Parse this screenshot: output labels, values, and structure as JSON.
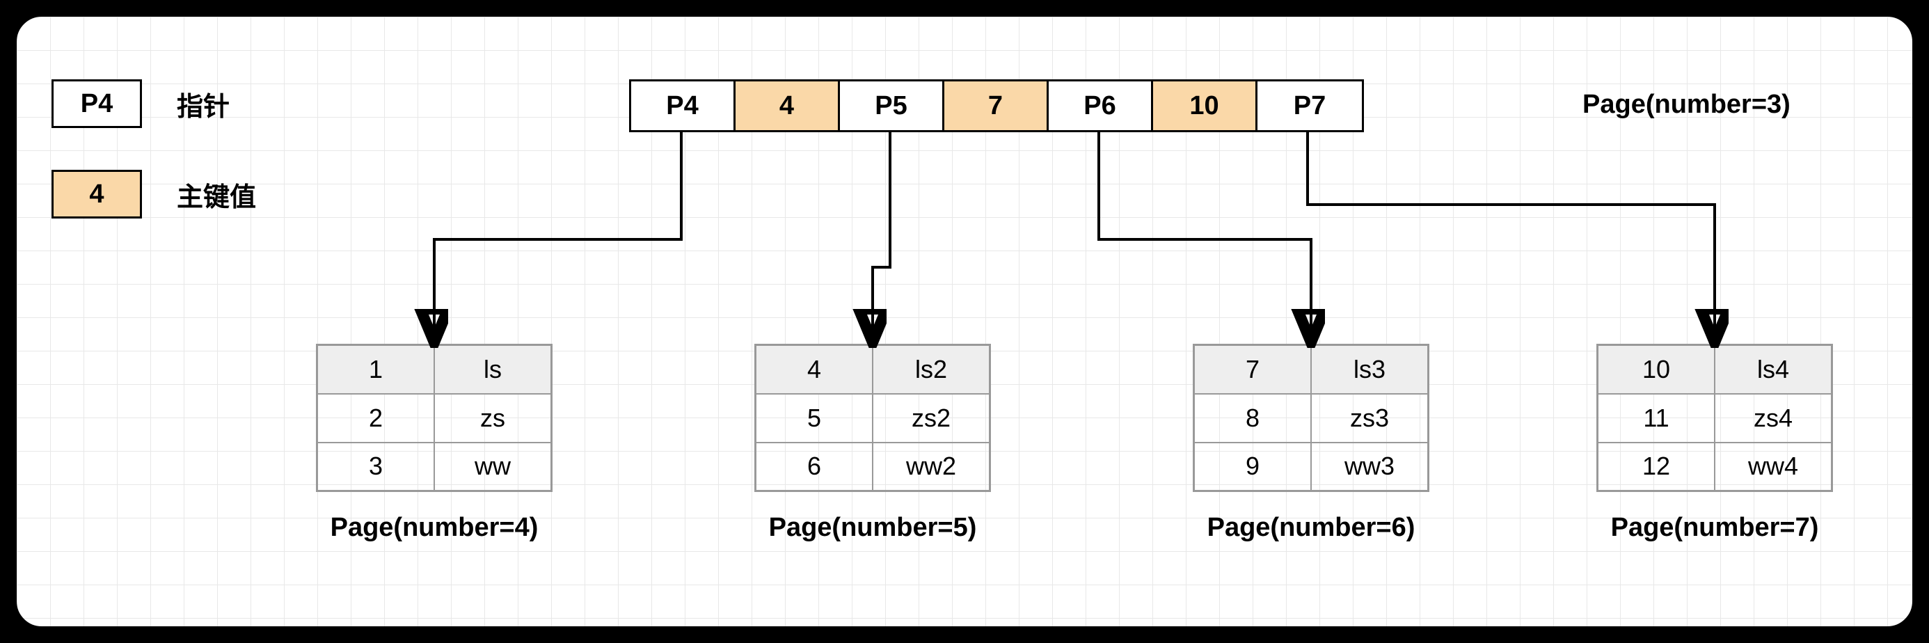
{
  "legend": {
    "pointer_box": "P4",
    "pointer_label": "指针",
    "key_box": "4",
    "key_label": "主键值"
  },
  "index": {
    "cells": [
      {
        "text": "P4",
        "type": "ptr"
      },
      {
        "text": "4",
        "type": "key"
      },
      {
        "text": "P5",
        "type": "ptr"
      },
      {
        "text": "7",
        "type": "key"
      },
      {
        "text": "P6",
        "type": "ptr"
      },
      {
        "text": "10",
        "type": "key"
      },
      {
        "text": "P7",
        "type": "ptr"
      }
    ],
    "caption": "Page(number=3)"
  },
  "leaves": [
    {
      "caption": "Page(number=4)",
      "rows": [
        {
          "k": "1",
          "v": "ls"
        },
        {
          "k": "2",
          "v": "zs"
        },
        {
          "k": "3",
          "v": "ww"
        }
      ]
    },
    {
      "caption": "Page(number=5)",
      "rows": [
        {
          "k": "4",
          "v": "ls2"
        },
        {
          "k": "5",
          "v": "zs2"
        },
        {
          "k": "6",
          "v": "ww2"
        }
      ]
    },
    {
      "caption": "Page(number=6)",
      "rows": [
        {
          "k": "7",
          "v": "ls3"
        },
        {
          "k": "8",
          "v": "zs3"
        },
        {
          "k": "9",
          "v": "ww3"
        }
      ]
    },
    {
      "caption": "Page(number=7)",
      "rows": [
        {
          "k": "10",
          "v": "ls4"
        },
        {
          "k": "11",
          "v": "zs4"
        },
        {
          "k": "12",
          "v": "ww4"
        }
      ]
    }
  ]
}
